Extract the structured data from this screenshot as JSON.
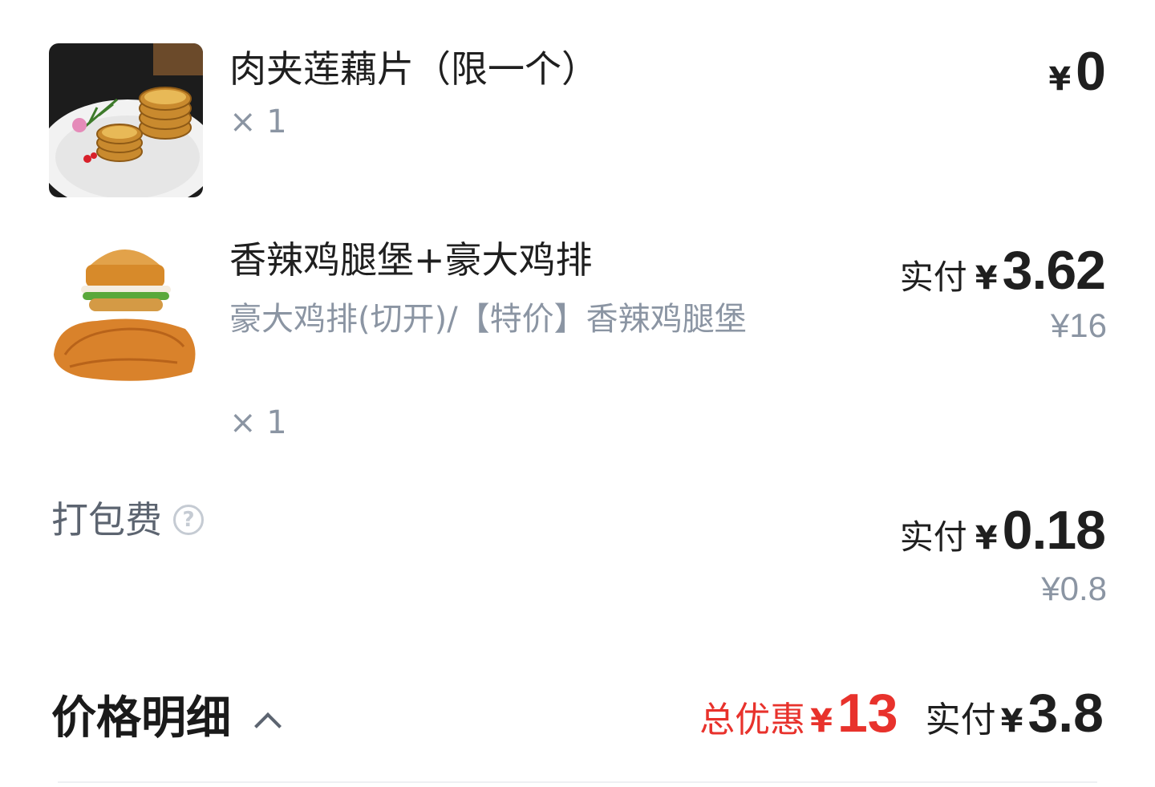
{
  "items": [
    {
      "name": "肉夹莲藕片（限一个）",
      "quantity": "× 1",
      "price_currency": "¥",
      "price": "0",
      "image_icon": "lotus-root-cake-image"
    },
    {
      "name": "香辣鸡腿堡+豪大鸡排",
      "spec": "豪大鸡排(切开)/【特价】香辣鸡腿堡",
      "quantity": "× 1",
      "pay_label": "实付",
      "price_currency": "¥",
      "price": "3.62",
      "original_price": "¥16",
      "image_icon": "burger-and-chicken-cutlet-image"
    }
  ],
  "packing_fee": {
    "label": "打包费",
    "help_icon": "question-circle-icon",
    "help_glyph": "?",
    "pay_label": "实付",
    "price_currency": "¥",
    "price": "0.18",
    "original_price": "¥0.8"
  },
  "price_detail": {
    "title": "价格明细",
    "toggle_icon": "chevron-up-icon",
    "discount_label": "总优惠",
    "discount_currency": "¥",
    "discount_amount": "13",
    "total_label": "实付",
    "total_currency": "¥",
    "total_amount": "3.8"
  },
  "colors": {
    "primary_text": "#1f1f1f",
    "secondary_text": "#8b95a3",
    "discount_red": "#e8322c"
  }
}
